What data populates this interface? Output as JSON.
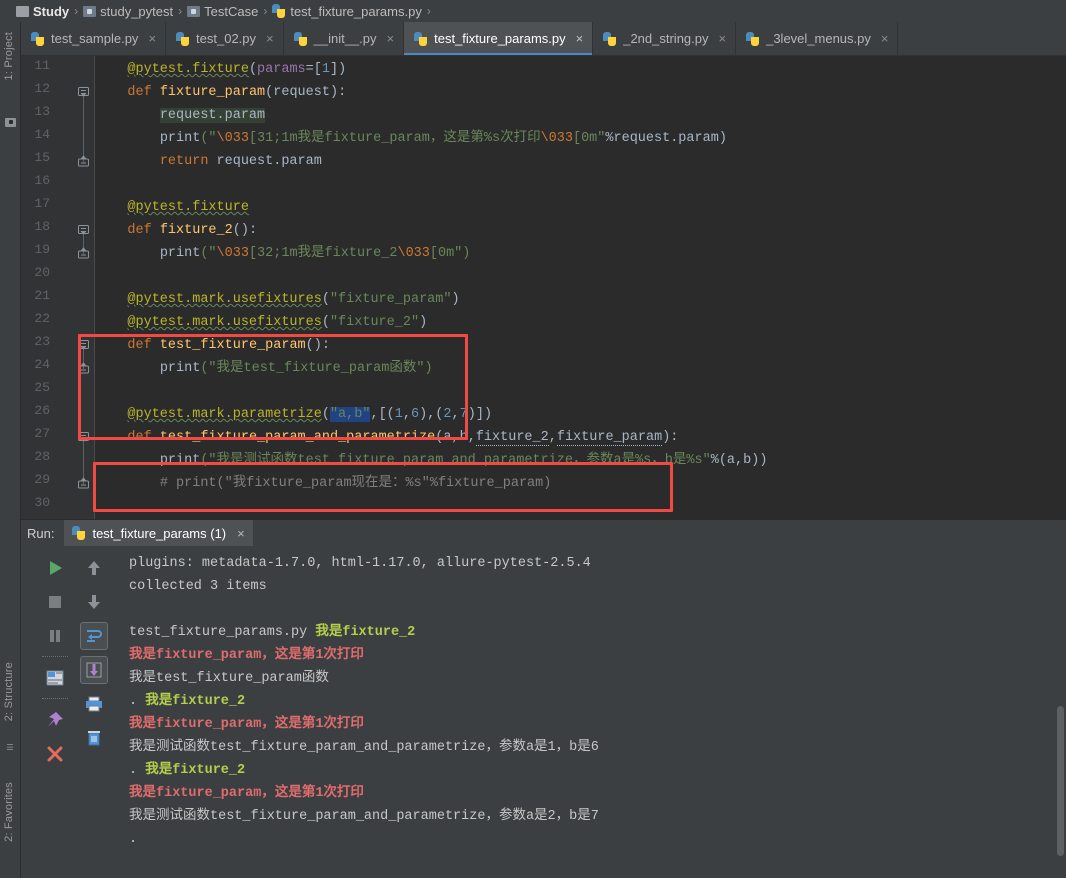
{
  "breadcrumb": {
    "items": [
      {
        "label": "Study",
        "icon": "folder-icon"
      },
      {
        "label": "study_pytest",
        "icon": "module-icon"
      },
      {
        "label": "TestCase",
        "icon": "module-icon"
      },
      {
        "label": "test_fixture_params.py",
        "icon": "python-file-icon"
      }
    ],
    "separator": "›"
  },
  "tabs": [
    {
      "label": "test_sample.py",
      "active": false,
      "close": "×"
    },
    {
      "label": "test_02.py",
      "active": false,
      "close": "×"
    },
    {
      "label": "__init__.py",
      "active": false,
      "close": "×"
    },
    {
      "label": "test_fixture_params.py",
      "active": true,
      "close": "×"
    },
    {
      "label": "_2nd_string.py",
      "active": false,
      "close": "×"
    },
    {
      "label": "_3level_menus.py",
      "active": false,
      "close": "×"
    }
  ],
  "sidebar": {
    "project_label": "1: Project",
    "structure_label": "2: Structure",
    "favorites_label": "2: Favorites"
  },
  "editor": {
    "first_line": 11,
    "lines": [
      {
        "n": 11,
        "text": "    @pytest.fixture(params=[1])"
      },
      {
        "n": 12,
        "text": "    def fixture_param(request):"
      },
      {
        "n": 13,
        "text": "        request.param"
      },
      {
        "n": 14,
        "text": "        print(\"\\033[31;1m我是fixture_param，这是第%s次打印\\033[0m\"%request.param)"
      },
      {
        "n": 15,
        "text": "        return request.param"
      },
      {
        "n": 16,
        "text": ""
      },
      {
        "n": 17,
        "text": "    @pytest.fixture"
      },
      {
        "n": 18,
        "text": "    def fixture_2():"
      },
      {
        "n": 19,
        "text": "        print(\"\\033[32;1m我是fixture_2\\033[0m\")"
      },
      {
        "n": 20,
        "text": ""
      },
      {
        "n": 21,
        "text": "    @pytest.mark.usefixtures(\"fixture_param\")"
      },
      {
        "n": 22,
        "text": "    @pytest.mark.usefixtures(\"fixture_2\")"
      },
      {
        "n": 23,
        "text": "    def test_fixture_param():"
      },
      {
        "n": 24,
        "text": "        print(\"我是test_fixture_param函数\")"
      },
      {
        "n": 25,
        "text": ""
      },
      {
        "n": 26,
        "text": "    @pytest.mark.parametrize(\"a,b\",[(1,6),(2,7)])"
      },
      {
        "n": 27,
        "text": "    def test_fixture_param_and_parametrize(a,b,fixture_2,fixture_param):"
      },
      {
        "n": 28,
        "text": "        print(\"我是测试函数test_fixture_param_and_parametrize，参数a是%s，b是%s\"%(a,b))"
      },
      {
        "n": 29,
        "text": "        # print(\"我fixture_param现在是：%s\"%fixture_param)"
      },
      {
        "n": 30,
        "text": ""
      }
    ],
    "annotations": [
      {
        "name": "usefixtures-highlight",
        "label": "red box around lines 21-24"
      },
      {
        "name": "parametrize-highlight",
        "label": "red box around lines 26-27"
      }
    ]
  },
  "run_panel": {
    "label": "Run:",
    "tab_label": "test_fixture_params (1)",
    "tab_close": "×",
    "toolbar": [
      {
        "name": "rerun-button",
        "icon": "play-icon"
      },
      {
        "name": "stop-button",
        "icon": "stop-icon"
      },
      {
        "name": "pause-button",
        "icon": "pause-icon"
      },
      {
        "name": "toggle-tasks-button",
        "icon": "test-list-icon"
      },
      {
        "name": "pin-tab-button",
        "icon": "pin-icon"
      },
      {
        "name": "close-button",
        "icon": "close-x-icon"
      },
      {
        "name": "up-stack-button",
        "icon": "arrow-up-icon"
      },
      {
        "name": "down-stack-button",
        "icon": "arrow-down-icon"
      },
      {
        "name": "soft-wrap-button",
        "icon": "soft-wrap-icon"
      },
      {
        "name": "scroll-to-end-button",
        "icon": "scroll-end-icon"
      },
      {
        "name": "print-button",
        "icon": "printer-icon"
      },
      {
        "name": "clear-all-button",
        "icon": "trash-icon"
      }
    ],
    "console_lines": [
      {
        "segments": [
          {
            "text": "plugins: metadata-1.7.0, html-1.17.0, allure-pytest-2.5.4",
            "style": "plain"
          }
        ]
      },
      {
        "segments": [
          {
            "text": "collected 3 items",
            "style": "plain"
          }
        ]
      },
      {
        "segments": [
          {
            "text": "",
            "style": "plain"
          }
        ]
      },
      {
        "segments": [
          {
            "text": "test_fixture_params.py ",
            "style": "plain"
          },
          {
            "text": "我是fixture_2",
            "style": "green"
          }
        ]
      },
      {
        "segments": [
          {
            "text": "我是fixture_param，这是第1次打印",
            "style": "red"
          }
        ]
      },
      {
        "segments": [
          {
            "text": "我是test_fixture_param函数",
            "style": "plain"
          }
        ]
      },
      {
        "segments": [
          {
            "text": ". ",
            "style": "plain"
          },
          {
            "text": "我是fixture_2",
            "style": "green"
          }
        ]
      },
      {
        "segments": [
          {
            "text": "我是fixture_param，这是第1次打印",
            "style": "red"
          }
        ]
      },
      {
        "segments": [
          {
            "text": "我是测试函数test_fixture_param_and_parametrize，参数a是1，b是6",
            "style": "plain"
          }
        ]
      },
      {
        "segments": [
          {
            "text": ". ",
            "style": "plain"
          },
          {
            "text": "我是fixture_2",
            "style": "green"
          }
        ]
      },
      {
        "segments": [
          {
            "text": "我是fixture_param，这是第1次打印",
            "style": "red"
          }
        ]
      },
      {
        "segments": [
          {
            "text": "我是测试函数test_fixture_param_and_parametrize，参数a是2，b是7",
            "style": "plain"
          }
        ]
      },
      {
        "segments": [
          {
            "text": ".",
            "style": "plain"
          }
        ]
      }
    ]
  },
  "colors": {
    "editor_bg": "#2b2b2b",
    "panel_bg": "#3c3f41",
    "gutter_bg": "#313335",
    "accent_tab": "#4a88c7",
    "annotation_red": "#f04a42",
    "console_green": "#b5cf4a",
    "console_red": "#e06c6c",
    "decorator_yellow": "#bbb529",
    "keyword_orange": "#cc7832",
    "function_gold": "#ffc66d",
    "string_green": "#6a8759"
  }
}
